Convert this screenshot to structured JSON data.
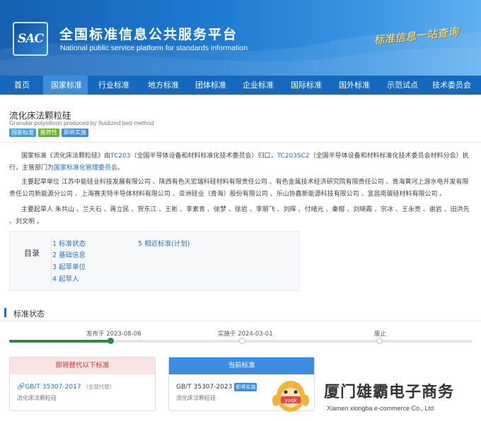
{
  "header": {
    "logo_text": "SAC",
    "title": "全国标准信息公共服务平台",
    "subtitle": "National public service platform  for standards information",
    "slogan": "标准信息一站查询"
  },
  "nav": [
    {
      "label": "首页",
      "active": false
    },
    {
      "label": "国家标准",
      "active": true
    },
    {
      "label": "行业标准",
      "active": false
    },
    {
      "label": "地方标准",
      "active": false
    },
    {
      "label": "团体标准",
      "active": false
    },
    {
      "label": "企业标准",
      "active": false
    },
    {
      "label": "国际标准",
      "active": false
    },
    {
      "label": "国外标准",
      "active": false
    },
    {
      "label": "示范试点",
      "active": false
    },
    {
      "label": "技术委员会",
      "active": false
    }
  ],
  "doc": {
    "title": "流化床法颗粒硅",
    "title_en": "Granular polysilicon produced by fluidized bed method",
    "tags": [
      "国家标准",
      "推荐性",
      "即将实施"
    ]
  },
  "intro": {
    "p1_a": "国家标准《流化床法颗粒硅》由",
    "p1_link1": "TC203",
    "p1_b": "（全国半导体设备和材料标准化技术委员会）归口，",
    "p1_link2": "TC203SC2",
    "p1_c": "（全国半导体设备和材料标准化技术委员会材料分会）执行，主管部门为",
    "p1_link3": "国家标准化管理委员会",
    "p1_d": "。",
    "p2": "主要起草单位 江苏中能硅业科技发展有限公司 、陕西有色天宏瑞科硅材料有限责任公司 、有色金属技术经济研究院有限责任公司 、青海黄河上游水电开发有限责任公司新能源分公司 、上海赛夫特半导体材料有限公司 、亚洲硅业（青海）股份有限公司 、乐山协鑫新能源科技有限公司 、宜昌南玻硅材料有限公司 。",
    "p3": "主要起草人 朱共山 、兰天石 、蒋立民 、贺东江 、王彬 、李素青 、徐梦 、徐岩 、李朋飞 、刘晖 、付绪光 、秦榕 、刘晓霞 、宗冰 、王永亮 、谢岩 、田洪先 、刘文明 。"
  },
  "toc": {
    "label": "目录",
    "items": [
      "1  标准状态",
      "2  基础信息",
      "3  起草单位",
      "4  起草人",
      "5  相近标准(计划)"
    ]
  },
  "status": {
    "section_title": "标准状态",
    "timeline": [
      {
        "label": "发布于 2023-08-06",
        "done": true
      },
      {
        "label": "实施于 2024-03-01",
        "done": false
      },
      {
        "label": "废止",
        "done": false
      }
    ],
    "progress_fraction": 0.22
  },
  "cards": {
    "replaced": {
      "head": "即将替代以下标准",
      "code": "GB/T 35307-2017",
      "note": "（全部代替）",
      "name": "流化床法颗粒硅"
    },
    "current": {
      "head": "当前标准",
      "code": "GB/T 35307-2023",
      "badge": "即将实施",
      "name": "流化床法颗粒硅"
    }
  },
  "watermark": {
    "mascot_text": "yoqk",
    "name": "厦门雄霸电子商务",
    "name_en": "Xiamen xiongba e-commerce Co., Ltd"
  }
}
